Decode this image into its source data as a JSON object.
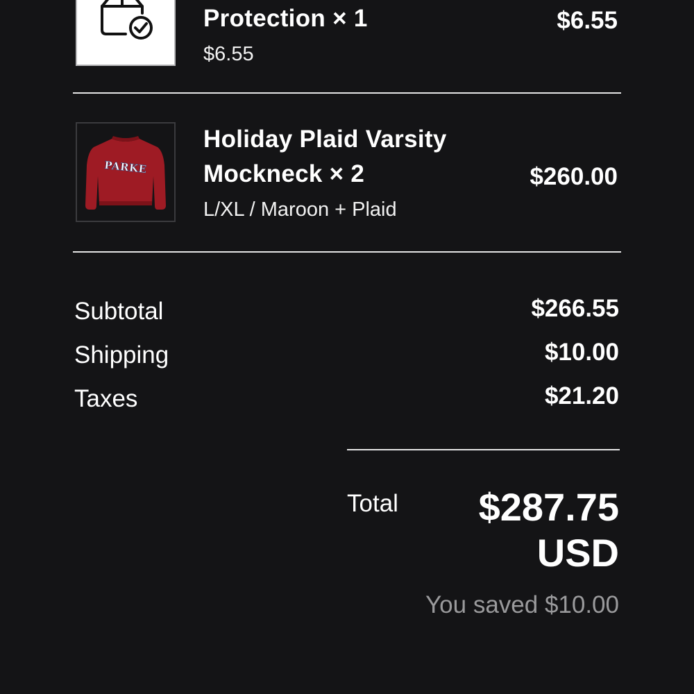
{
  "items": [
    {
      "title": "Protection × 1",
      "subtitle": "$6.55",
      "price": "$6.55",
      "icon": "package-protection-icon"
    },
    {
      "title_line1": "Holiday Plaid Varsity",
      "title_line2": "Mockneck × 2",
      "variant": "L/XL / Maroon + Plaid",
      "price": "$260.00",
      "image_text": "PARKE"
    }
  ],
  "summary": {
    "subtotal_label": "Subtotal",
    "subtotal_value": "$266.55",
    "shipping_label": "Shipping",
    "shipping_value": "$10.00",
    "taxes_label": "Taxes",
    "taxes_value": "$21.20"
  },
  "total": {
    "label": "Total",
    "amount": "$287.75",
    "currency": "USD",
    "savings": "You saved $10.00"
  },
  "colors": {
    "background": "#141416",
    "text": "#ffffff",
    "muted": "#9a9a9c",
    "sweater": "#9e1b24"
  }
}
